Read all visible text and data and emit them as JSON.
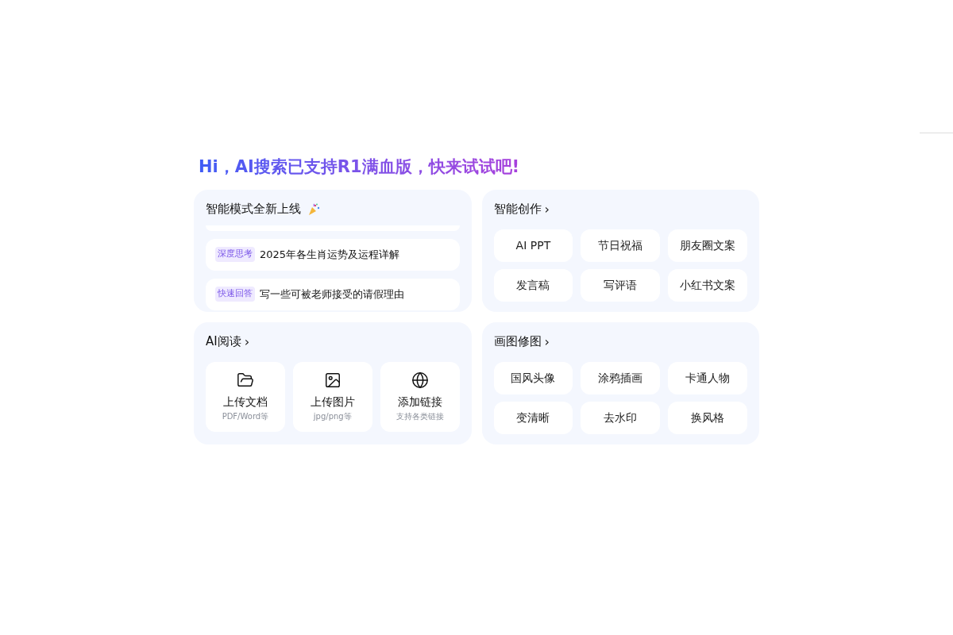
{
  "headline": "Hi，AI搜索已支持R1满血版，快来试试吧!",
  "smart_mode": {
    "title": "智能模式全新上线",
    "prompts": [
      {
        "tag": "深度思考",
        "text": "2025年各生肖运势及运程详解"
      },
      {
        "tag": "快速回答",
        "text": "写一些可被老师接受的请假理由"
      }
    ]
  },
  "creation": {
    "title": "智能创作",
    "chevron": "›",
    "items": [
      "AI PPT",
      "节日祝福",
      "朋友圈文案",
      "发言稿",
      "写评语",
      "小红书文案"
    ]
  },
  "reading": {
    "title": "AI阅读",
    "chevron": "›",
    "items": [
      {
        "kind": "folder",
        "label": "上传文档",
        "hint": "PDF/Word等"
      },
      {
        "kind": "image",
        "label": "上传图片",
        "hint": "jpg/png等"
      },
      {
        "kind": "globe",
        "label": "添加链接",
        "hint": "支持各类链接"
      }
    ]
  },
  "drawing": {
    "title": "画图修图",
    "chevron": "›",
    "items": [
      "国风头像",
      "涂鸦插画",
      "卡通人物",
      "变清晰",
      "去水印",
      "换风格"
    ]
  }
}
